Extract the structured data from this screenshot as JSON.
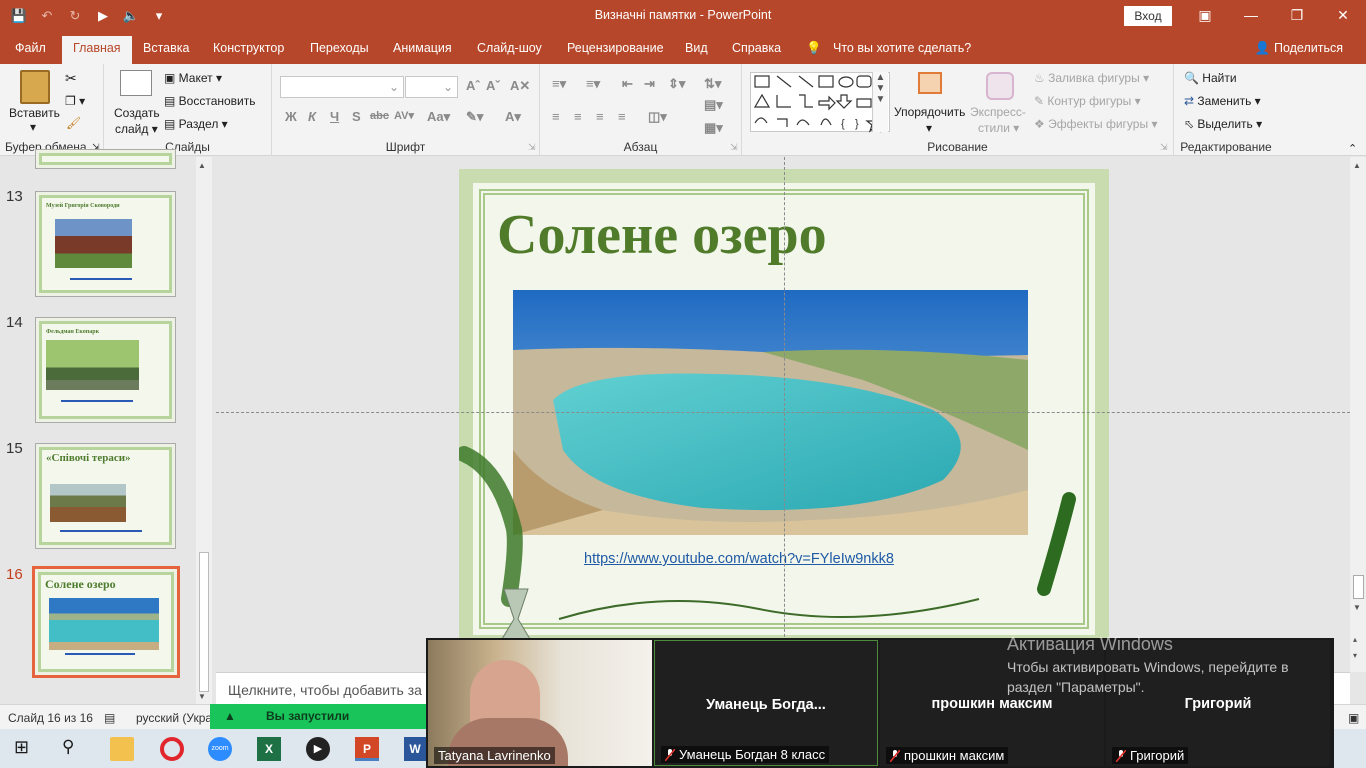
{
  "titlebar": {
    "doc_title": "Визначні памятки  -  PowerPoint",
    "signin_label": "Вход"
  },
  "menu": {
    "tabs": [
      "Файл",
      "Главная",
      "Вставка",
      "Конструктор",
      "Переходы",
      "Анимация",
      "Слайд-шоу",
      "Рецензирование",
      "Вид",
      "Справка"
    ],
    "tell_me": "Что вы хотите сделать?",
    "share": "Поделиться"
  },
  "ribbon": {
    "clipboard": {
      "paste": "Вставить",
      "label": "Буфер обмена"
    },
    "slides": {
      "new_slide_1": "Создать",
      "new_slide_2": "слайд",
      "layout": "Макет",
      "reset": "Восстановить",
      "section": "Раздел",
      "label": "Слайды"
    },
    "font": {
      "label": "Шрифт",
      "bold": "Ж",
      "italic": "К",
      "underline": "Ч",
      "shadow": "S",
      "strike": "abc"
    },
    "paragraph": {
      "label": "Абзац"
    },
    "drawing": {
      "arrange_1": "Упорядочить",
      "quick_styles_1": "Экспресс-",
      "quick_styles_2": "стили",
      "shape_fill": "Заливка фигуры",
      "shape_outline": "Контур фигуры",
      "shape_effects": "Эффекты фигуры",
      "label": "Рисование"
    },
    "editing": {
      "find": "Найти",
      "replace": "Заменить",
      "select": "Выделить",
      "label": "Редактирование"
    }
  },
  "thumbnails": [
    {
      "num": "13",
      "title": "Музей Григорія Сковороди"
    },
    {
      "num": "14",
      "title": "Фельдман Екопарк"
    },
    {
      "num": "15",
      "title": "«Співочі тераси»"
    },
    {
      "num": "16",
      "title": "Солене озеро"
    }
  ],
  "slide": {
    "title": "Солене озеро",
    "link": "https://www.youtube.com/watch?v=FYleIw9nkk8"
  },
  "notes": {
    "placeholder": "Щелкните, чтобы добавить за"
  },
  "status": {
    "slide_counter": "Слайд 16 из 16",
    "language": "русский (Укра",
    "share_banner": "Вы запустили демонстраци"
  },
  "zoom": {
    "tiles": [
      {
        "big_name": "",
        "label": "Tatyana Lavrinenko"
      },
      {
        "big_name": "Уманець  Богда...",
        "label": "Уманець Богдан 8 класс"
      },
      {
        "big_name": "прошкин максим",
        "label": "прошкин максим"
      },
      {
        "big_name": "Григорий",
        "label": "Григорий"
      }
    ]
  },
  "watermark": {
    "title": "Активация Windows",
    "body": "Чтобы активировать Windows, перейдите в раздел \"Параметры\"."
  },
  "colors": {
    "accent": "#b7472a",
    "title_green": "#4f7b2a",
    "link_blue": "#1f5aa6",
    "banner_green": "#19c45b"
  }
}
